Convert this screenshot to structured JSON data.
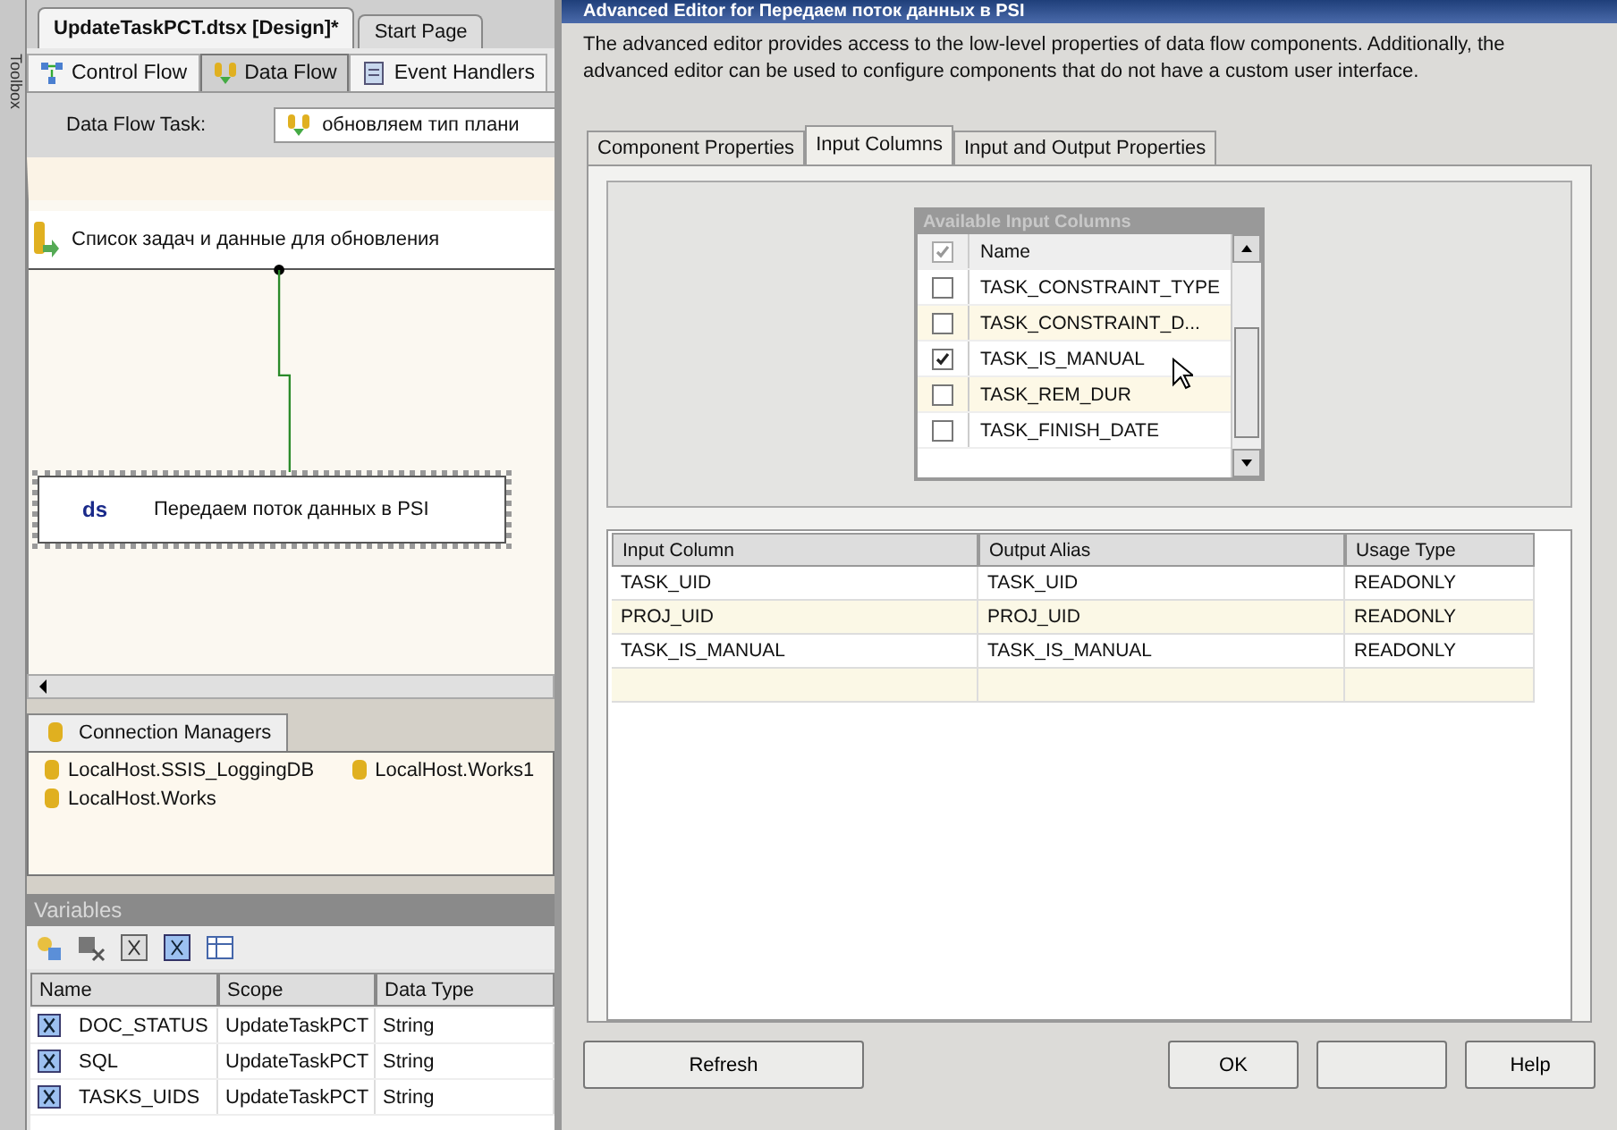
{
  "toolbox": {
    "label": "Toolbox"
  },
  "editor_tabs": [
    {
      "label": "UpdateTaskPCT.dtsx [Design]*",
      "selected": true
    },
    {
      "label": "Start Page",
      "selected": false
    }
  ],
  "designer_tabs": [
    {
      "label": "Control Flow",
      "selected": false
    },
    {
      "label": "Data Flow",
      "selected": true
    },
    {
      "label": "Event Handlers",
      "selected": false
    }
  ],
  "data_flow_task": {
    "label": "Data Flow Task:",
    "value": "обновляем тип плани"
  },
  "canvas": {
    "nodes": [
      {
        "kind": "source",
        "label": "Список задач и данные для обновления",
        "selected": false
      },
      {
        "kind": "destination",
        "badge": "ds",
        "label": "Передаем поток данных в PSI",
        "selected": true
      }
    ]
  },
  "connection_managers": {
    "tab": "Connection Managers",
    "items": [
      "LocalHost.SSIS_LoggingDB",
      "LocalHost.Works1",
      "LocalHost.Works"
    ]
  },
  "variables": {
    "title": "Variables",
    "columns": [
      "Name",
      "Scope",
      "Data Type"
    ],
    "rows": [
      [
        "DOC_STATUS",
        "UpdateTaskPCT",
        "String"
      ],
      [
        "SQL",
        "UpdateTaskPCT",
        "String"
      ],
      [
        "TASKS_UIDS",
        "UpdateTaskPCT",
        "String"
      ]
    ]
  },
  "dialog": {
    "title": "Advanced Editor for Передаем поток данных в PSI",
    "description": "The advanced editor provides access to the low-level properties of data flow components. Additionally, the advanced editor can be used to configure components that do not have a custom user interface.",
    "tabs": [
      {
        "label": "Component Properties",
        "selected": false
      },
      {
        "label": "Input Columns",
        "selected": true
      },
      {
        "label": "Input and Output Properties",
        "selected": false
      }
    ],
    "available_columns": {
      "title": "Available Input Columns",
      "header": "Name",
      "header_checked": true,
      "rows": [
        {
          "name": "TASK_CONSTRAINT_TYPE",
          "checked": false
        },
        {
          "name": "TASK_CONSTRAINT_D...",
          "checked": false
        },
        {
          "name": "TASK_IS_MANUAL",
          "checked": true
        },
        {
          "name": "TASK_REM_DUR",
          "checked": false
        },
        {
          "name": "TASK_FINISH_DATE",
          "checked": false
        }
      ]
    },
    "mapping": {
      "columns": [
        "Input Column",
        "Output Alias",
        "Usage Type"
      ],
      "rows": [
        [
          "TASK_UID",
          "TASK_UID",
          "READONLY"
        ],
        [
          "PROJ_UID",
          "PROJ_UID",
          "READONLY"
        ],
        [
          "TASK_IS_MANUAL",
          "TASK_IS_MANUAL",
          "READONLY"
        ]
      ]
    },
    "buttons": [
      {
        "kind": "text",
        "label": "Refresh"
      },
      {
        "kind": "spacer"
      },
      {
        "kind": "text",
        "label": "OK"
      },
      {
        "kind": "blank"
      },
      {
        "kind": "text",
        "label": "Help"
      }
    ]
  }
}
